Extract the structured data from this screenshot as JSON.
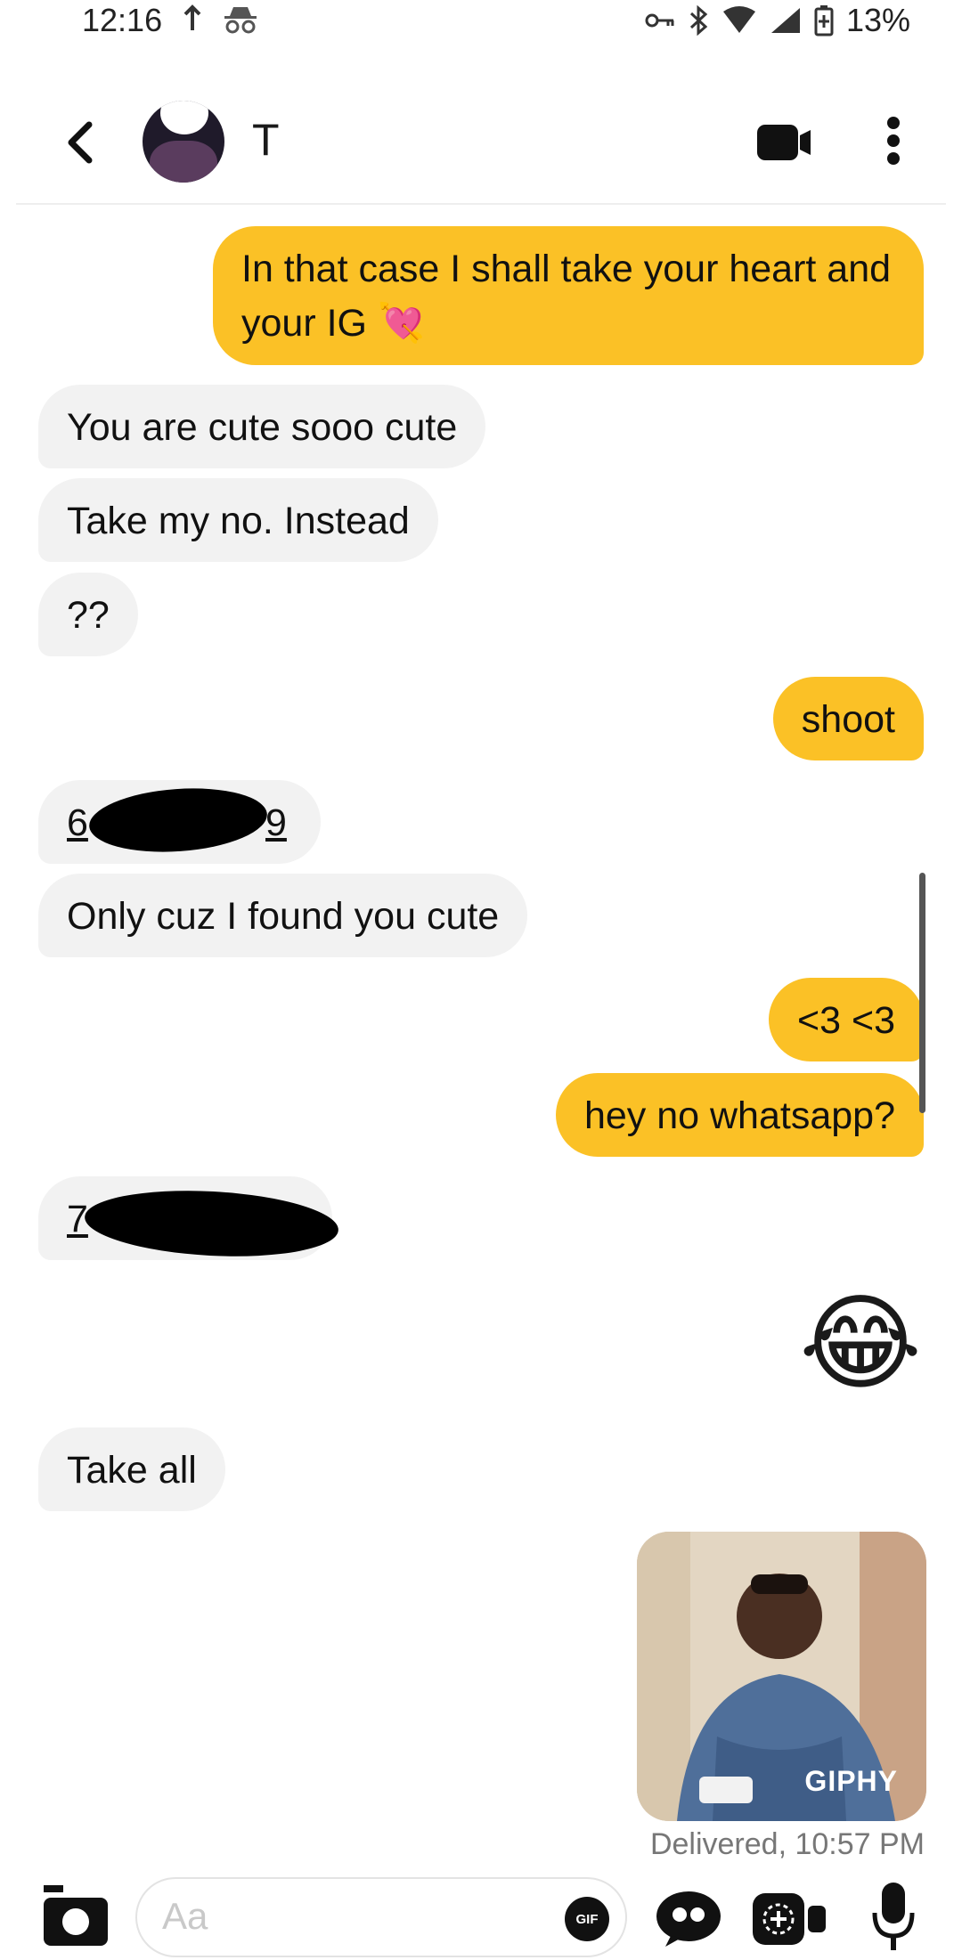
{
  "status_bar": {
    "time": "12:16",
    "notif_icons": [
      "upload-arrow-icon",
      "incognito-icon"
    ],
    "system_icons": [
      "vpn-key-icon",
      "bluetooth-icon",
      "wifi-icon",
      "cell-signal-icon",
      "battery-icon"
    ],
    "battery_percent": "13%"
  },
  "header": {
    "back_icon": "chevron-left-icon",
    "contact_name": "T",
    "video_icon": "video-camera-icon",
    "menu_icon": "more-vertical-icon"
  },
  "messages": [
    {
      "side": "out",
      "text": "In that case I shall take your heart and your IG 💘"
    },
    {
      "side": "in",
      "text": "You are cute sooo cute"
    },
    {
      "side": "in",
      "text": "Take my no. Instead"
    },
    {
      "side": "in",
      "text": "??"
    },
    {
      "side": "out",
      "text": "shoot"
    },
    {
      "side": "in",
      "text": "6",
      "tail": "9",
      "redacted": true
    },
    {
      "side": "in",
      "text": "Only cuz I found you  cute"
    },
    {
      "side": "out",
      "text": "<3 <3"
    },
    {
      "side": "out",
      "text": "hey no whatsapp?"
    },
    {
      "side": "in",
      "text": "7",
      "redacted": true
    },
    {
      "side": "out",
      "text": "😂",
      "emoji": true
    },
    {
      "side": "in",
      "text": "Take all"
    },
    {
      "side": "out",
      "gif_label": "GIPHY"
    }
  ],
  "delivery_status": "Delivered, 10:57 PM",
  "composer": {
    "camera_icon": "camera-icon",
    "placeholder": "Aa",
    "gif_button": "GIF",
    "quote_icon": "quote-icon",
    "add_media_icon": "add-media-icon",
    "mic_icon": "microphone-icon"
  },
  "colors": {
    "outgoing_bubble": "#fbc126",
    "incoming_bubble": "#f2f2f2"
  }
}
